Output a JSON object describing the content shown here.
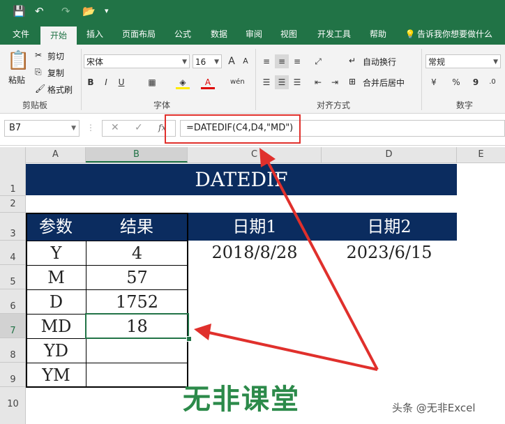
{
  "quick_access": {
    "save": "💾",
    "undo": "↶",
    "redo": "↷",
    "open": "📂",
    "more": "▾"
  },
  "tabs": [
    "文件",
    "开始",
    "插入",
    "页面布局",
    "公式",
    "数据",
    "审阅",
    "视图",
    "开发工具",
    "帮助",
    "告诉我你想要做什么"
  ],
  "ribbon": {
    "paste": "粘贴",
    "cut": "剪切",
    "copy": "复制",
    "format_painter": "格式刷",
    "clipboard": "剪贴板",
    "font_name": "宋体",
    "font_size": "16",
    "bold": "B",
    "italic": "I",
    "underline": "U",
    "font_group": "字体",
    "wrap_text": "自动换行",
    "merge_center": "合并后居中",
    "align_group": "对齐方式",
    "number_format": "常规",
    "percent": "%",
    "comma": "9",
    "number_group": "数字"
  },
  "formula_bar": {
    "name_box": "B7",
    "formula": "=DATEDIF(C4,D4,\"MD\")",
    "fx": "fx"
  },
  "columns": [
    "A",
    "B",
    "C",
    "D",
    "E"
  ],
  "rows": [
    "1",
    "2",
    "3",
    "4",
    "5",
    "6",
    "7",
    "8",
    "9",
    "10"
  ],
  "sheet": {
    "title": "DATEDIF",
    "header_param": "参数",
    "header_result": "结果",
    "header_date1": "日期1",
    "header_date2": "日期2",
    "date1": "2018/8/28",
    "date2": "2023/6/15",
    "params": [
      "Y",
      "M",
      "D",
      "MD",
      "YD",
      "YM"
    ],
    "results": [
      "4",
      "57",
      "1752",
      "18",
      "",
      ""
    ]
  },
  "watermark": {
    "logo_text": "无非课堂",
    "author": "头条 @无非Excel"
  },
  "colors": {
    "excel_green": "#217346",
    "header_navy": "#0b2c5f",
    "annotation_red": "#e0302c"
  }
}
